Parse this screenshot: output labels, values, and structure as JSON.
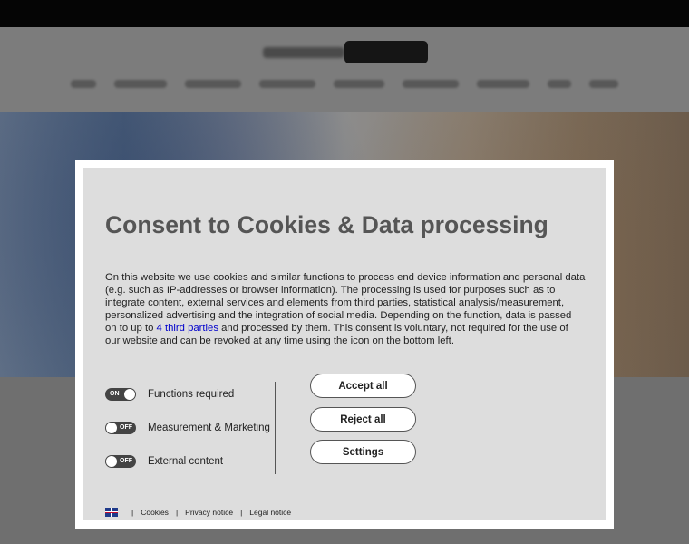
{
  "consent": {
    "title": "Consent to Cookies & Data processing",
    "description_part1": "On this website we use cookies and similar functions to process end device information and personal data (e.g. such as IP-addresses or browser information). The processing is used for purposes such as to integrate content, external services and elements from third parties, statistical analysis/measurement, personalized advertising and the integration of social media. Depending on the function, data is passed on to up to ",
    "description_link": "4 third parties",
    "description_part2": " and processed by them. This consent is voluntary, not required for the use of our website and can be revoked at any time using the icon on the bottom left.",
    "toggles": [
      {
        "label": "Functions required",
        "state": "ON"
      },
      {
        "label": "Measurement & Marketing",
        "state": "OFF"
      },
      {
        "label": "External content",
        "state": "OFF"
      }
    ],
    "buttons": {
      "accept_all": "Accept all",
      "reject_all": "Reject all",
      "settings": "Settings"
    },
    "footer": {
      "language_icon": "uk-flag-icon",
      "separator": "|",
      "cookies": "Cookies",
      "privacy": "Privacy notice",
      "legal": "Legal notice"
    }
  }
}
